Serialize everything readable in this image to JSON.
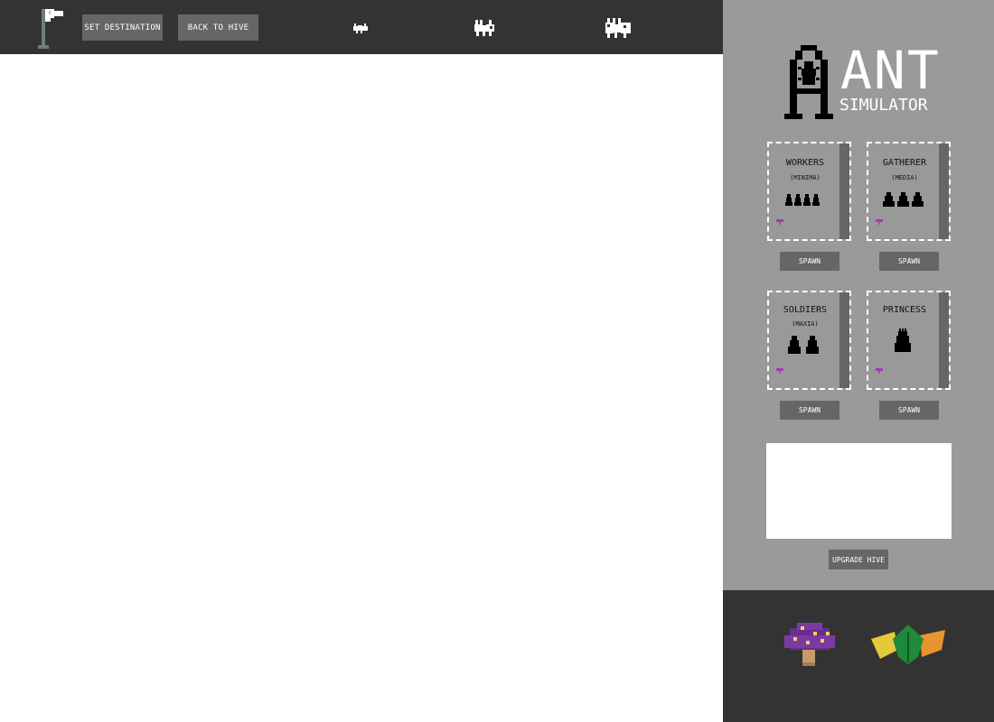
{
  "toolbar": {
    "set_destination_label": "SET DESTINATION",
    "back_to_hive_label": "BACK TO HIVE",
    "flag_icon": "flag-icon",
    "ant_sizes": [
      "ant-small-icon",
      "ant-medium-icon",
      "ant-large-icon"
    ]
  },
  "logo": {
    "title": "ANT",
    "subtitle": "SIMULATOR"
  },
  "units": [
    {
      "title": "WORKERS",
      "subtitle": "(MINIMA)",
      "ant_count": 4,
      "spawn_label": "SPAWN"
    },
    {
      "title": "GATHERER",
      "subtitle": "(MEDIA)",
      "ant_count": 3,
      "spawn_label": "SPAWN"
    },
    {
      "title": "SOLDIERS",
      "subtitle": "(MAXIA)",
      "ant_count": 2,
      "spawn_label": "SPAWN"
    },
    {
      "title": "PRINCESS",
      "subtitle": "",
      "ant_count": 1,
      "spawn_label": "SPAWN"
    }
  ],
  "upgrade_label": "UPGRADE HIVE",
  "resources": [
    "mushroom-icon",
    "leaves-icon"
  ],
  "colors": {
    "topbar": "#333333",
    "sidebar": "#9a9a9a",
    "button": "#666666",
    "food": "#9b3fb0"
  }
}
